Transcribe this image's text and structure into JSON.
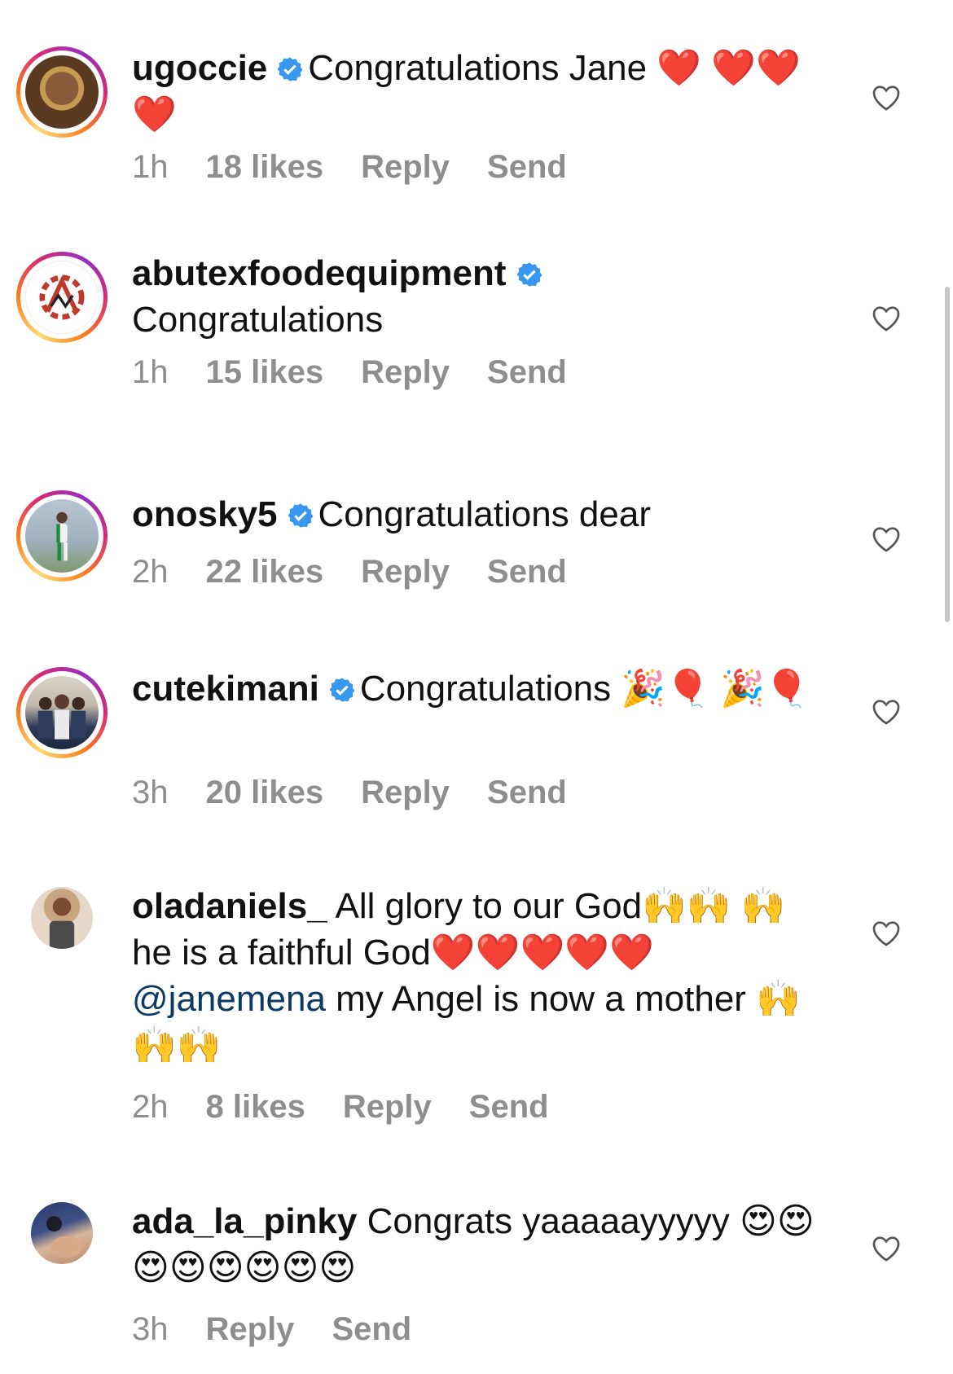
{
  "comments": [
    {
      "username": "ugoccie",
      "verified": true,
      "text": "Congratulations Jane ❤️ ❤️❤️❤️",
      "time": "1h",
      "likes": "18 likes",
      "reply": "Reply",
      "send": "Send"
    },
    {
      "username": "abutexfoodequipment",
      "verified": true,
      "text": "Congratulations",
      "time": "1h",
      "likes": "15 likes",
      "reply": "Reply",
      "send": "Send"
    },
    {
      "username": "onosky5",
      "verified": true,
      "text": "Congratulations dear",
      "time": "2h",
      "likes": "22 likes",
      "reply": "Reply",
      "send": "Send"
    },
    {
      "username": "cutekimani",
      "verified": true,
      "text": "Congratulations 🎉🎈 🎉🎈",
      "time": "3h",
      "likes": "20 likes",
      "reply": "Reply",
      "send": "Send"
    },
    {
      "username": "oladaniels_",
      "verified": false,
      "text_before": "All glory to our God🙌🙌 🙌 he is a faithful God❤️❤️❤️❤️❤️",
      "mention": "@janemena",
      "text_after": "my Angel is now a mother 🙌🙌🙌",
      "time": "2h",
      "likes": "8 likes",
      "reply": "Reply",
      "send": "Send"
    },
    {
      "username": "ada_la_pinky",
      "verified": false,
      "text": "Congrats yaaaaayyyyy 😍😍😍😍😍😍😍😍",
      "time": "3h",
      "reply": "Reply",
      "send": "Send"
    }
  ],
  "colors": {
    "verified_badge": "#3897f0",
    "meta_text": "#8e8e8e",
    "mention": "#0b3a66",
    "story_ring": [
      "#feda75",
      "#fa7e1e",
      "#d62976",
      "#962fbf"
    ]
  },
  "icons": {
    "verified": "verified-badge-icon",
    "like": "heart-outline-icon"
  }
}
